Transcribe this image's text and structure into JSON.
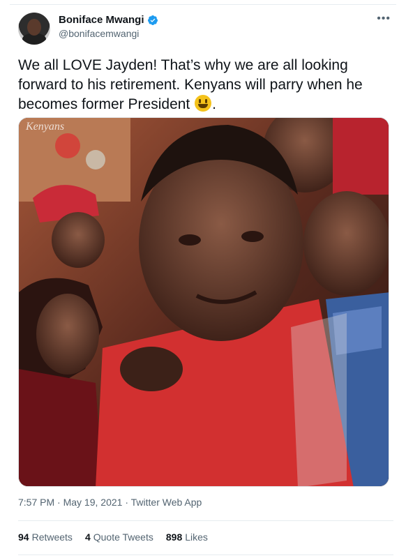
{
  "author": {
    "name": "Boniface Mwangi",
    "handle": "@bonifacemwangi",
    "verified": true
  },
  "tweet": {
    "text_lines": [
      "We all LOVE Jayden! That’s why we are all looking",
      "forward to his retirement. Kenyans will parry when he",
      "becomes former President "
    ],
    "text_end": ".",
    "emoji": "smiley-emoji"
  },
  "media": {
    "watermark": "Kenyans",
    "description_icon": "photo"
  },
  "meta": {
    "time": "7:57 PM",
    "date": "May 19, 2021",
    "source": "Twitter Web App",
    "separator": " · "
  },
  "stats": [
    {
      "count": "94",
      "label": "Retweets"
    },
    {
      "count": "4",
      "label": "Quote Tweets"
    },
    {
      "count": "898",
      "label": "Likes"
    }
  ],
  "colors": {
    "text": "#0f1419",
    "secondary": "#536471",
    "verified": "#1d9bf0",
    "divider": "#e6ecf0"
  }
}
